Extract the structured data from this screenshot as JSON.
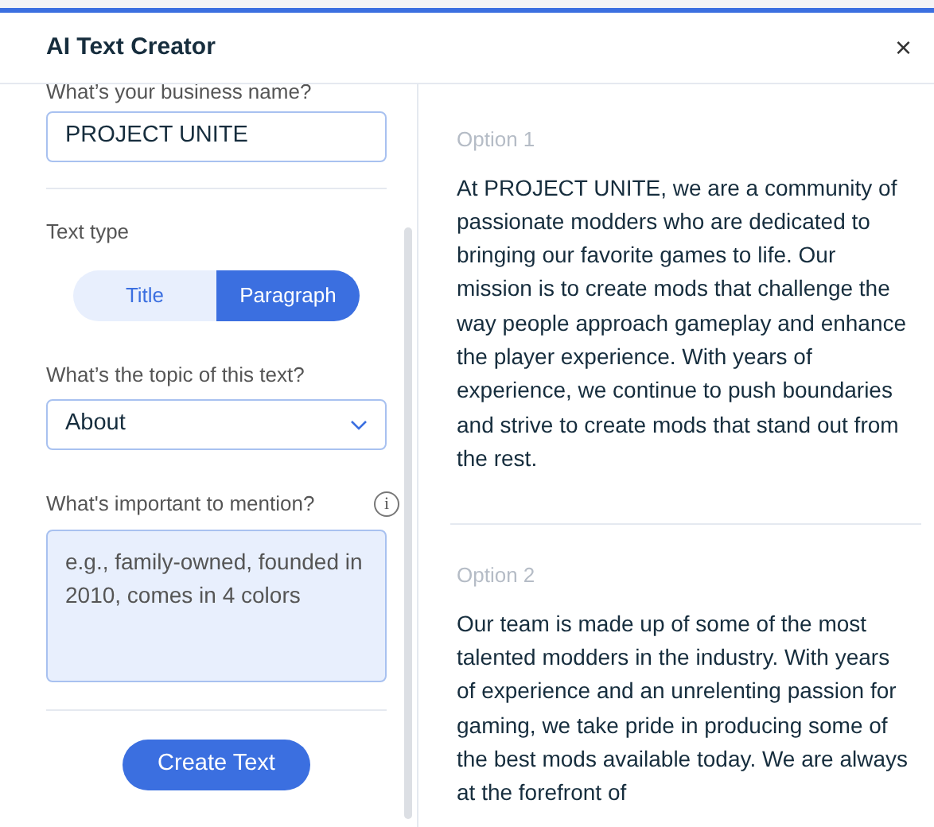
{
  "window": {
    "title": "AI Text Creator",
    "close": "×"
  },
  "form": {
    "business_name": {
      "label": "What’s your business name?",
      "value": "PROJECT UNITE"
    },
    "text_type": {
      "label": "Text type",
      "options": [
        {
          "label": "Title",
          "selected": false
        },
        {
          "label": "Paragraph",
          "selected": true
        }
      ]
    },
    "topic": {
      "label": "What’s the topic of this text?",
      "value": "About"
    },
    "mention": {
      "label": "What's important to mention?",
      "info": "i",
      "placeholder": "e.g., family-owned, founded in 2010, comes in 4 colors"
    },
    "submit": "Create Text"
  },
  "options": [
    {
      "label": "Option 1",
      "text": "At PROJECT UNITE, we are a community of passionate modders who are dedicated to bringing our favorite games to life. Our mission is to create mods that challenge the way people approach gameplay and enhance the player experience. With years of experience, we continue to push boundaries and strive to create mods that stand out from the rest."
    },
    {
      "label": "Option 2",
      "text": "Our team is made up of some of the most talented modders in the industry. With years of experience and an unrelenting passion for gaming, we take pride in producing some of the best mods available today. We are always at the forefront of"
    }
  ]
}
